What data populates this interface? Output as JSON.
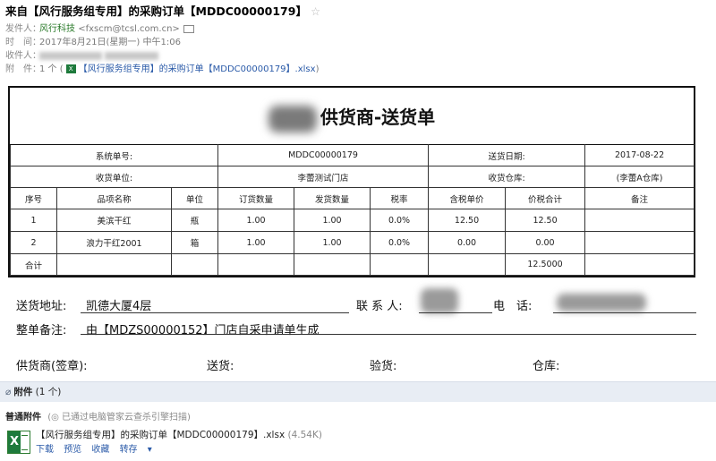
{
  "email": {
    "subject": "来自【风行服务组专用】的采购订单【MDDC00000179】",
    "sender_label": "发件人：",
    "sender_name": "风行科技",
    "sender_email": "<fxscm@tcsl.com.cn>",
    "time_label": "时　间：",
    "time_value": "2017年8月21日(星期一) 中午1:06",
    "recipient_label": "收件人：",
    "attach_label": "附　件：",
    "attach_count": "1 个",
    "attach_paren_open": "(",
    "attach_file": "【风行服务组专用】的采购订单【MDDC00000179】.xlsx",
    "attach_paren_close": ")"
  },
  "sheet": {
    "title": "供货商-送货单",
    "system_no_label": "系统单号:",
    "system_no": "MDDC00000179",
    "delivery_date_label": "送货日期:",
    "delivery_date": "2017-08-22",
    "receiver_label": "收货单位:",
    "receiver": "李蕾测试门店",
    "warehouse_label": "收货仓库:",
    "warehouse": "(李蕾A仓库)",
    "columns": [
      "序号",
      "品项名称",
      "单位",
      "订货数量",
      "发货数量",
      "税率",
      "含税单价",
      "价税合计",
      "备注"
    ],
    "rows": [
      [
        "1",
        "美滨干红",
        "瓶",
        "1.00",
        "1.00",
        "0.0%",
        "12.50",
        "12.50",
        ""
      ],
      [
        "2",
        "浪力干红2001",
        "箱",
        "1.00",
        "1.00",
        "0.0%",
        "0.00",
        "0.00",
        ""
      ]
    ],
    "total_label": "合计",
    "total_value": "12.5000"
  },
  "footer_form": {
    "address_label": "送货地址:",
    "address_value": "凯德大厦4层",
    "contact_label": "联 系 人:",
    "phone_label": "电　话:",
    "remark_label": "整单备注:",
    "remark_value": "由【MDZS00000152】门店自采申请单生成",
    "supplier_sign_label": "供货商(签章):",
    "deliver_label": "送货:",
    "inspect_label": "验货:",
    "warehouse_label": "仓库:"
  },
  "attachments": {
    "header_label": "附件",
    "header_count": "(1 个)",
    "normal_label": "普通附件",
    "scan_text": "已通过电脑管家云查杀引擎扫描",
    "file_name": "【风行服务组专用】的采购订单【MDDC00000179】.xlsx",
    "file_size": "(4.54K)",
    "actions": [
      "下载",
      "预览",
      "收藏",
      "转存"
    ]
  }
}
